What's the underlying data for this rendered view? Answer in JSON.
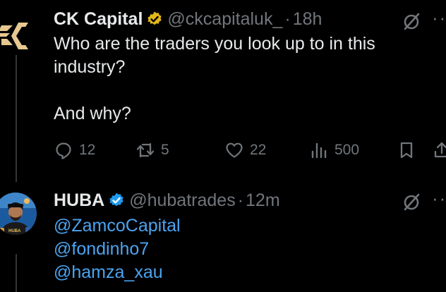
{
  "tweet1": {
    "name": "CK Capital",
    "handle": "@ckcapitaluk_",
    "separator": "·",
    "time": "18h",
    "more": "··",
    "text": "Who are the traders you look up to in this\nindustry?\n\nAnd why?",
    "actions": {
      "replies": "12",
      "reposts": "5",
      "likes": "22",
      "views": "500"
    }
  },
  "tweet2": {
    "name": "HUBA",
    "handle": "@hubatrades",
    "separator": "·",
    "time": "12m",
    "more": "··",
    "avatar_caption": "HUBA",
    "mentions": [
      "@ZamcoCapital",
      "@fondinho7",
      "@hamza_xau"
    ]
  },
  "colors": {
    "background": "#000000",
    "text": "#e7e9ea",
    "muted": "#71767b",
    "link": "#4aa4f0",
    "gold_badge": "#e2b719",
    "blue_badge": "#1d9bf0"
  }
}
